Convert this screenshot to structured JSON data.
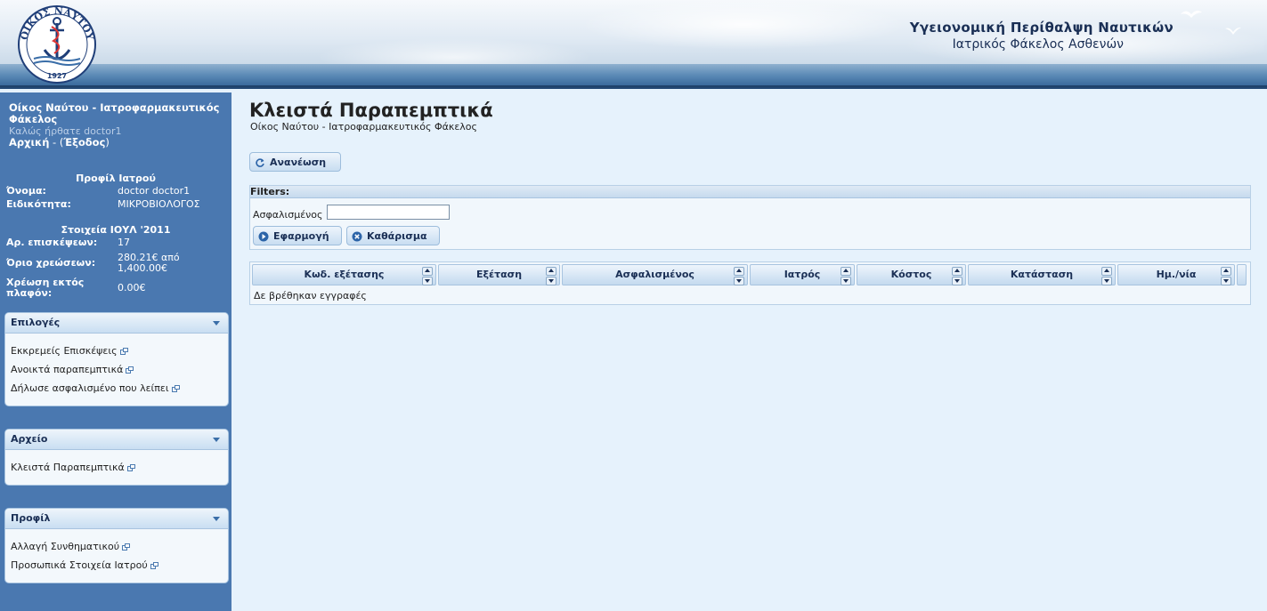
{
  "header": {
    "logo_text_top": "ΟΙΚΟΣ ΝΑΥΤΟΥ",
    "logo_year": "1927",
    "title": "Υγειονομική Περίθαλψη Ναυτικών",
    "subtitle": "Ιατρικός Φάκελος Ασθενών"
  },
  "sidebar": {
    "app_name": "Οίκος Ναύτου - Ιατροφαρμακευτικός Φάκελος",
    "welcome": "Καλώς ήρθατε doctor1",
    "home_link": "Αρχική",
    "sep1": " - (",
    "logout_link": "Έξοδος",
    "sep2": ")",
    "profile": {
      "title": "Προφίλ Ιατρού",
      "name_label": "Όνομα:",
      "name_value": "doctor doctor1",
      "specialty_label": "Ειδικότητα:",
      "specialty_value": "ΜΙΚΡΟΒΙΟΛΟΓΟΣ"
    },
    "stats": {
      "title": "Στοιχεία ΙΟΥΛ '2011",
      "visits_label": "Αρ. επισκέψεων:",
      "visits_value": "17",
      "limit_label": "Όριο χρεώσεων:",
      "limit_value": "280.21€ από 1,400.00€",
      "over_label": "Χρέωση εκτός πλαφόν:",
      "over_value": "0.00€"
    },
    "panels": [
      {
        "title": "Επιλογές",
        "items": [
          "Εκκρεμείς Επισκέψεις",
          "Ανοικτά παραπεμπτικά",
          "Δήλωσε ασφαλισμένο που λείπει"
        ]
      },
      {
        "title": "Αρχείο",
        "items": [
          "Κλειστά Παραπεμπτικά"
        ]
      },
      {
        "title": "Προφίλ",
        "items": [
          "Αλλαγή Συνθηματικού",
          "Προσωπικά Στοιχεία Ιατρού"
        ]
      }
    ]
  },
  "main": {
    "title": "Κλειστά Παραπεμπτικά",
    "subtitle": "Οίκος Ναύτου - Ιατροφαρμακευτικός Φάκελος",
    "refresh_label": "Ανανέωση",
    "filters": {
      "header": "Filters:",
      "insured_label": "Ασφαλισμένος",
      "insured_value": "",
      "apply_label": "Εφαρμογή",
      "clear_label": "Καθάρισμα"
    },
    "grid": {
      "columns": [
        "Κωδ. εξέτασης",
        "Εξέταση",
        "Ασφαλισμένος",
        "Ιατρός",
        "Κόστος",
        "Κατάσταση",
        "Ημ./νία"
      ],
      "empty_message": "Δε βρέθηκαν εγγραφές"
    }
  },
  "colors": {
    "sidebar_bg": "#4a78b0",
    "main_bg": "#e6f2fc",
    "accent_dark": "#1a2f55",
    "border": "#a8c4e0"
  }
}
